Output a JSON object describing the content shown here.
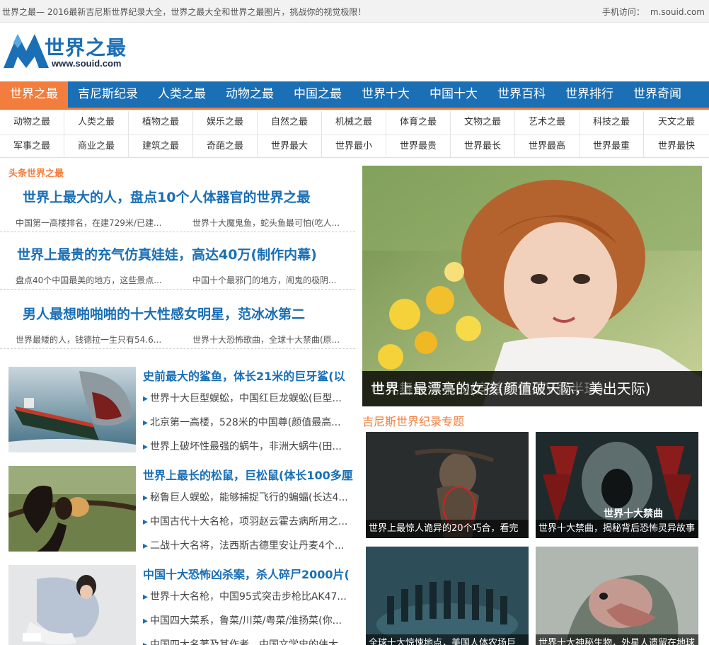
{
  "topbar": {
    "tagline": "世界之最— 2016最新吉尼斯世界纪录大全，世界之最大全和世界之最图片，挑战你的视觉极限！",
    "mobile_label": "手机访问：",
    "mobile_domain": "m.souid.com"
  },
  "logo": {
    "text": "世界之最",
    "url": "www.souid.com"
  },
  "main_nav": [
    "世界之最",
    "吉尼斯纪录",
    "人类之最",
    "动物之最",
    "中国之最",
    "世界十大",
    "中国十大",
    "世界百科",
    "世界排行",
    "世界奇闻"
  ],
  "sub_nav": [
    [
      "动物之最",
      "人类之最",
      "植物之最",
      "娱乐之最",
      "自然之最",
      "机械之最",
      "体育之最",
      "文物之最",
      "艺术之最",
      "科技之最",
      "天文之最"
    ],
    [
      "军事之最",
      "商业之最",
      "建筑之最",
      "奇葩之最",
      "世界最大",
      "世界最小",
      "世界最贵",
      "世界最长",
      "世界最高",
      "世界最重",
      "世界最快"
    ]
  ],
  "headlines_section": {
    "title": "头条世界之最",
    "items": [
      {
        "title": "世界上最大的人，盘点10个人体器官的世界之最",
        "subs": [
          "中国第一高楼排名，在建729米/已建...",
          "世界十大魔鬼鱼，蛇头鱼最可怕(吃人..."
        ]
      },
      {
        "title": "世界上最贵的充气仿真娃娃，高达40万(制作内幕)",
        "subs": [
          "盘点40个中国最美的地方，这些景点...",
          "中国十个最邪门的地方，闹鬼的极阴..."
        ]
      },
      {
        "title": "男人最想啪啪啪的十大性感女明星，范冰冰第二",
        "subs": [
          "世界最矮的人，钱德拉一生只有54.6...",
          "世界十大恐怖歌曲，全球十大禁曲(原..."
        ]
      }
    ]
  },
  "posts": [
    {
      "title": "史前最大的鲨鱼，体长21米的巨牙鲨(以",
      "links": [
        "世界十大巨型蜈蚣，中国红巨龙蜈蚣(巨型...",
        "北京第一高楼，528米的中国尊(颜值最高...",
        "世界上破坏性最强的蜗牛，非洲大蜗牛(田..."
      ],
      "thumb": "shark-ship-photo"
    },
    {
      "title": "世界上最长的松鼠，巨松鼠(体长100多厘",
      "links": [
        "秘鲁巨人蜈蚣，能够捕捉飞行的蝙蝠(长达4...",
        "中国古代十大名枪，项羽赵云霍去病所用之...",
        "二战十大名将，法西斯古德里安让丹麦4个..."
      ],
      "thumb": "squirrel-photo"
    },
    {
      "title": "中国十大恐怖凶杀案，杀人碎尸2000片(",
      "links": [
        "世界十大名枪，中国95式突击步枪比AK47...",
        "中国四大菜系，鲁菜/川菜/粤菜/淮扬菜(你...",
        "中国四大名著及其作者，中国文学史的伟大..."
      ],
      "thumb": "girl-lying-photo"
    }
  ],
  "hero": {
    "caption": "世界上最漂亮的女孩(颜值破天际，美出天际)",
    "caption_ghost": "电竞舞娘惹争议(穿着暴露深V露半球)"
  },
  "topics": {
    "title": "吉尼斯世界纪录专题",
    "cards": [
      {
        "caption": "世界上最惊人诡异的20个巧合，看完",
        "image": "dark-woman-photo"
      },
      {
        "caption": "世界十大禁曲，揭秘背后恐怖灵异故事",
        "image_text": "世界十大禁曲",
        "image": "horror-face-photo"
      },
      {
        "caption": "全球十大惊悚地点，美国人体农场巨",
        "image": "underwater-statues-photo"
      },
      {
        "caption": "世界十大神秘生物，外星人遗留在地球",
        "image": "creature-photo"
      }
    ]
  },
  "colors": {
    "brand_blue": "#1a6fb5",
    "accent_orange": "#f37d3c"
  }
}
